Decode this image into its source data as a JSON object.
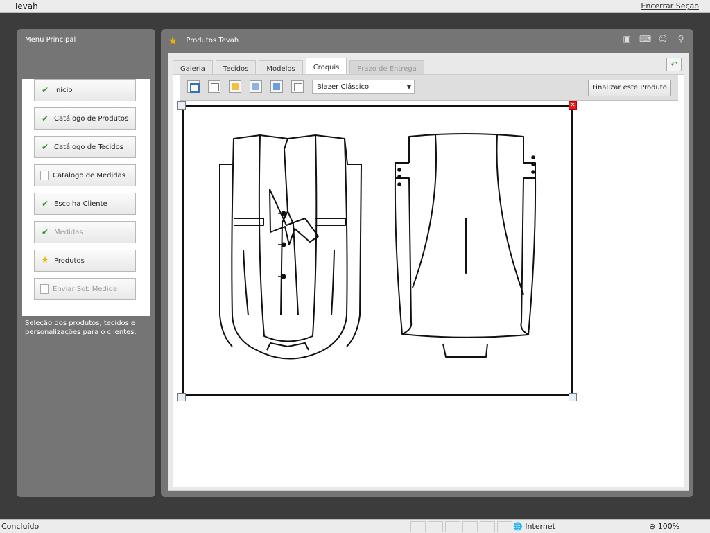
{
  "app": {
    "title": "Tevah",
    "logout_label": "Encerrar Seção"
  },
  "sidebar": {
    "title": "Menu Principal",
    "items": [
      {
        "label": "Início",
        "icon": "check-icon",
        "enabled": true
      },
      {
        "label": "Catálogo de Produtos",
        "icon": "check-icon",
        "enabled": true
      },
      {
        "label": "Catálogo de Tecidos",
        "icon": "check-icon",
        "enabled": true
      },
      {
        "label": "Catálogo de Medidas",
        "icon": "document-icon",
        "enabled": true
      },
      {
        "label": "Escolha Cliente",
        "icon": "check-icon",
        "enabled": true
      },
      {
        "label": "Medidas",
        "icon": "check-icon",
        "enabled": false
      },
      {
        "label": "Produtos",
        "icon": "star-icon",
        "enabled": true
      },
      {
        "label": "Enviar Sob Medida",
        "icon": "document-icon",
        "enabled": false
      }
    ],
    "description": "Seleção dos produtos, tecidos e personalizações para o clientes."
  },
  "main": {
    "header_title": "Produtos Tevah",
    "header_icons": [
      "save-icon",
      "keyboard-icon",
      "user-icon",
      "search-icon"
    ],
    "tabs": [
      {
        "label": "Galeria",
        "state": "normal"
      },
      {
        "label": "Tecidos",
        "state": "normal"
      },
      {
        "label": "Modelos",
        "state": "normal"
      },
      {
        "label": "Croquis",
        "state": "active"
      },
      {
        "label": "Prazo de Entrega",
        "state": "disabled"
      }
    ],
    "toolbar": {
      "tools": [
        "select-tool-icon",
        "document-tool-icon",
        "edit-tool-icon",
        "image-tool-icon",
        "shape-tool-icon",
        "page-tool-icon"
      ],
      "select_value": "Blazer Clássico",
      "finish_label": "Finalizar este Produto"
    }
  },
  "statusbar": {
    "status": "Concluído",
    "zone": "Internet",
    "zoom": "100%"
  }
}
